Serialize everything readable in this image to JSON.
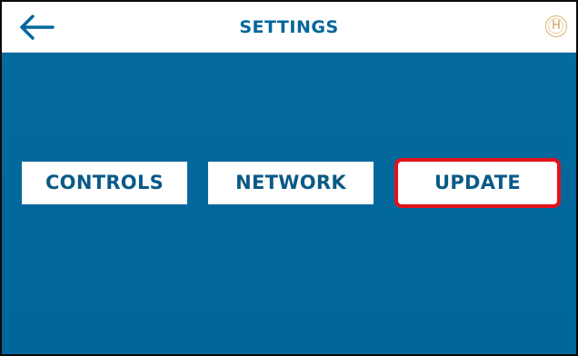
{
  "header": {
    "back_icon": "arrow-left-icon",
    "title": "SETTINGS",
    "badge_letter": "H",
    "badge_icon": "h-coin-icon"
  },
  "menu": {
    "items": [
      {
        "label": "CONTROLS"
      },
      {
        "label": "NETWORK"
      },
      {
        "label": "UPDATE",
        "highlighted": true
      }
    ]
  },
  "colors": {
    "background": "#02699d",
    "header_bg": "#ffffff",
    "title_text": "#03679b",
    "button_bg": "#ffffff",
    "button_text": "#0a5a86",
    "highlight_border": "#e3111b",
    "badge": "#d9b36a"
  }
}
